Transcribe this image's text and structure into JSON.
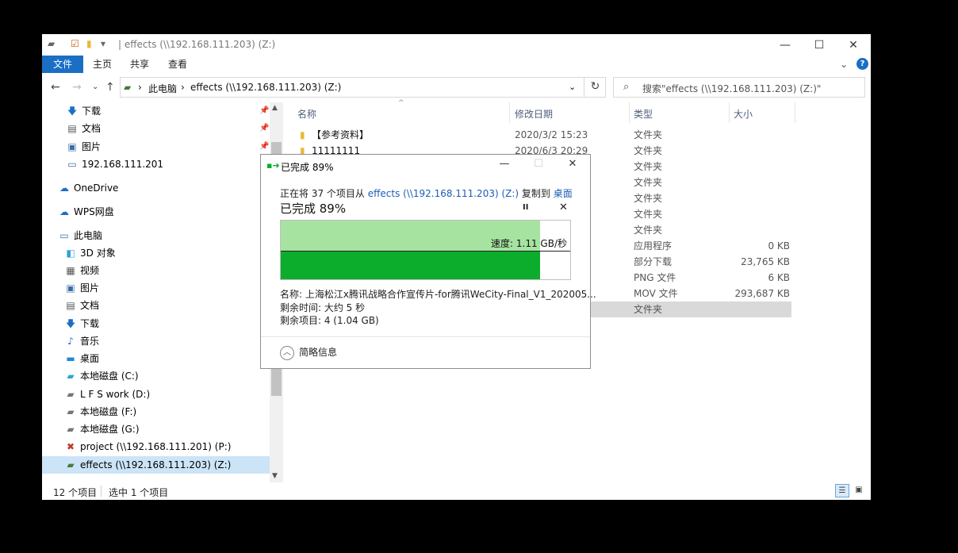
{
  "window": {
    "title": "| effects (\\\\192.168.111.203) (Z:)",
    "minimize": "—",
    "maximize": "☐",
    "close": "✕"
  },
  "ribbon": {
    "tabs": [
      "文件",
      "主页",
      "共享",
      "查看"
    ],
    "collapse": "⌄",
    "help": "?"
  },
  "address": {
    "root": "此电脑",
    "current": "effects (\\\\192.168.111.203) (Z:)",
    "separator": "›"
  },
  "search": {
    "placeholder": "搜索\"effects (\\\\192.168.111.203) (Z:)\""
  },
  "nav": {
    "quick": [
      {
        "label": "下载",
        "icon": "download-icon"
      },
      {
        "label": "文档",
        "icon": "document-icon"
      },
      {
        "label": "图片",
        "icon": "picture-icon"
      },
      {
        "label": "192.168.111.201",
        "icon": "network-drive-icon"
      }
    ],
    "onedrive": "OneDrive",
    "wps": "WPS网盘",
    "thispc": "此电脑",
    "pc_items": [
      "3D 对象",
      "视频",
      "图片",
      "文档",
      "下载",
      "音乐",
      "桌面",
      "本地磁盘 (C:)",
      "L F S work (D:)",
      "本地磁盘 (F:)",
      "本地磁盘 (G:)",
      "project (\\\\192.168.111.201) (P:)",
      "effects (\\\\192.168.111.203) (Z:)"
    ]
  },
  "columns": {
    "name": "名称",
    "date": "修改日期",
    "type": "类型",
    "size": "大小"
  },
  "rows": [
    {
      "name": "【参考资料】",
      "date": "2020/3/2 15:23",
      "type": "文件夹",
      "size": ""
    },
    {
      "name": "11111111",
      "date": "2020/6/3 20:29",
      "type": "文件夹",
      "size": ""
    },
    {
      "name": "",
      "date": "",
      "type": "文件夹",
      "size": ""
    },
    {
      "name": "",
      "date": "",
      "type": "文件夹",
      "size": ""
    },
    {
      "name": "",
      "date": "",
      "type": "文件夹",
      "size": ""
    },
    {
      "name": "",
      "date": "",
      "type": "文件夹",
      "size": ""
    },
    {
      "name": "",
      "date": "",
      "type": "文件夹",
      "size": ""
    },
    {
      "name": "",
      "date": "",
      "type": "应用程序",
      "size": "0 KB"
    },
    {
      "name": "",
      "date": "",
      "type": "部分下载",
      "size": "23,765 KB"
    },
    {
      "name": "",
      "date": "",
      "type": "PNG 文件",
      "size": "6 KB"
    },
    {
      "name": "",
      "date": "",
      "type": "MOV 文件",
      "size": "293,687 KB"
    },
    {
      "name": "",
      "date": "",
      "type": "文件夹",
      "size": ""
    }
  ],
  "status": {
    "count": "12 个项目",
    "selected": "选中 1 个项目"
  },
  "dialog": {
    "title": "已完成 89%",
    "copy_prefix": "正在将 37 个项目从",
    "copy_source": "effects (\\\\192.168.111.203) (Z:)",
    "copy_mid": "复制到",
    "copy_dest": "桌面",
    "progress_text": "已完成 89%",
    "progress_fraction": 0.89,
    "speed": "速度: 1.11 GB/秒",
    "name_line": "名称: 上海松江x腾讯战略合作宣传片-for腾讯WeCity-Final_V1_202005...",
    "time_line": "剩余时间: 大约 5 秒",
    "items_line": "剩余项目: 4 (1.04 GB)",
    "brief": "简略信息",
    "pause": "II",
    "cancel": "✕"
  },
  "colors": {
    "accent": "#1a6fc4",
    "progress_green": "#0cad2d",
    "progress_light": "#a6e3a1"
  }
}
